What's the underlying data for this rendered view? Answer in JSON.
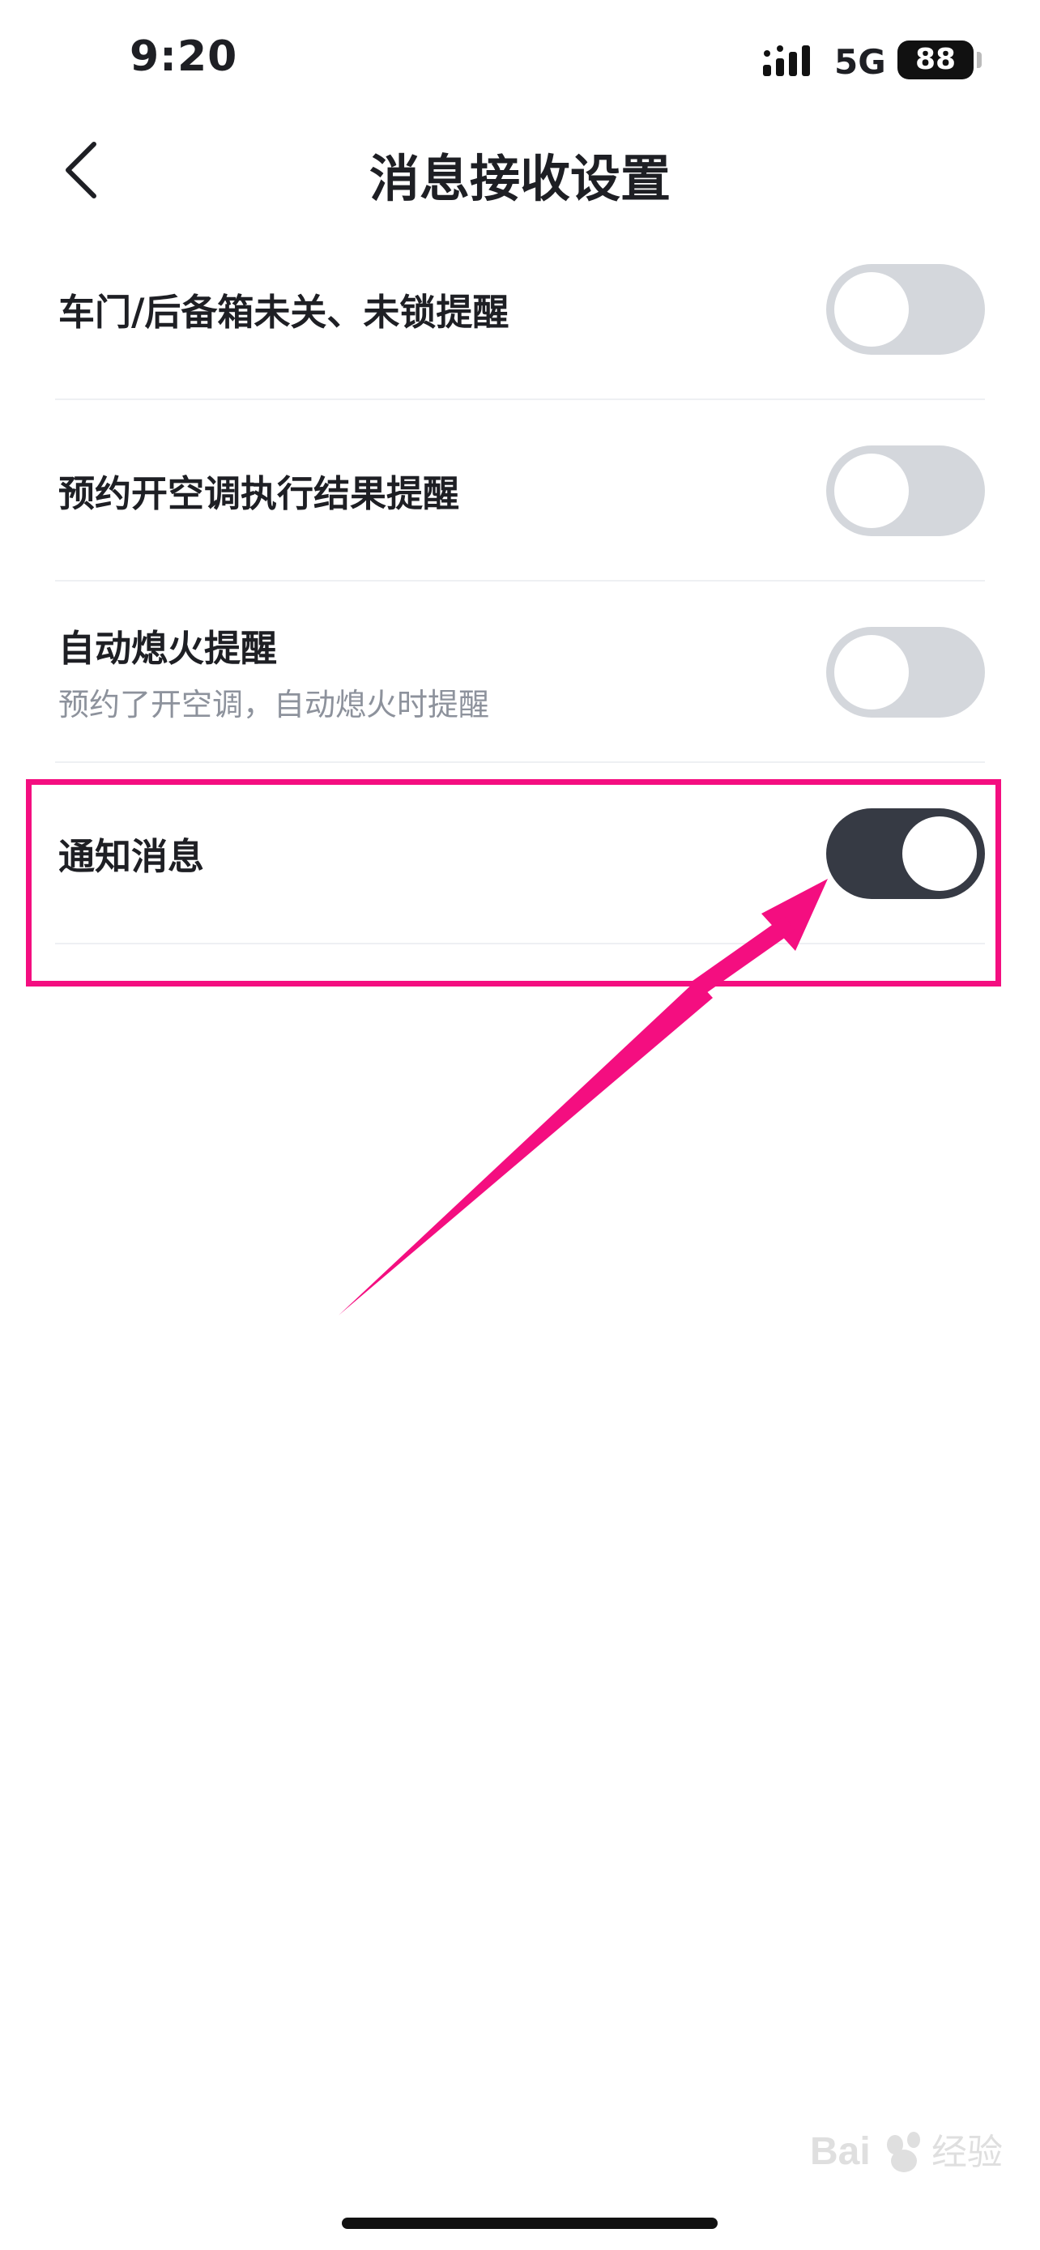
{
  "status_bar": {
    "time": "9:20",
    "network": "5G",
    "battery": "88"
  },
  "nav": {
    "title": "消息接收设置",
    "back_icon": "chevron-left-icon"
  },
  "settings": [
    {
      "label": "车门/后备箱未关、未锁提醒",
      "description": "",
      "enabled": false
    },
    {
      "label": "预约开空调执行结果提醒",
      "description": "",
      "enabled": false
    },
    {
      "label": "自动熄火提醒",
      "description": "预约了开空调，自动熄火时提醒",
      "enabled": false
    },
    {
      "label": "通知消息",
      "description": "",
      "enabled": true
    }
  ],
  "colors": {
    "toggle_on": "#363a44",
    "toggle_off": "#d4d7dc",
    "annotation": "#f40e80"
  },
  "watermark": "Baidu 经验"
}
